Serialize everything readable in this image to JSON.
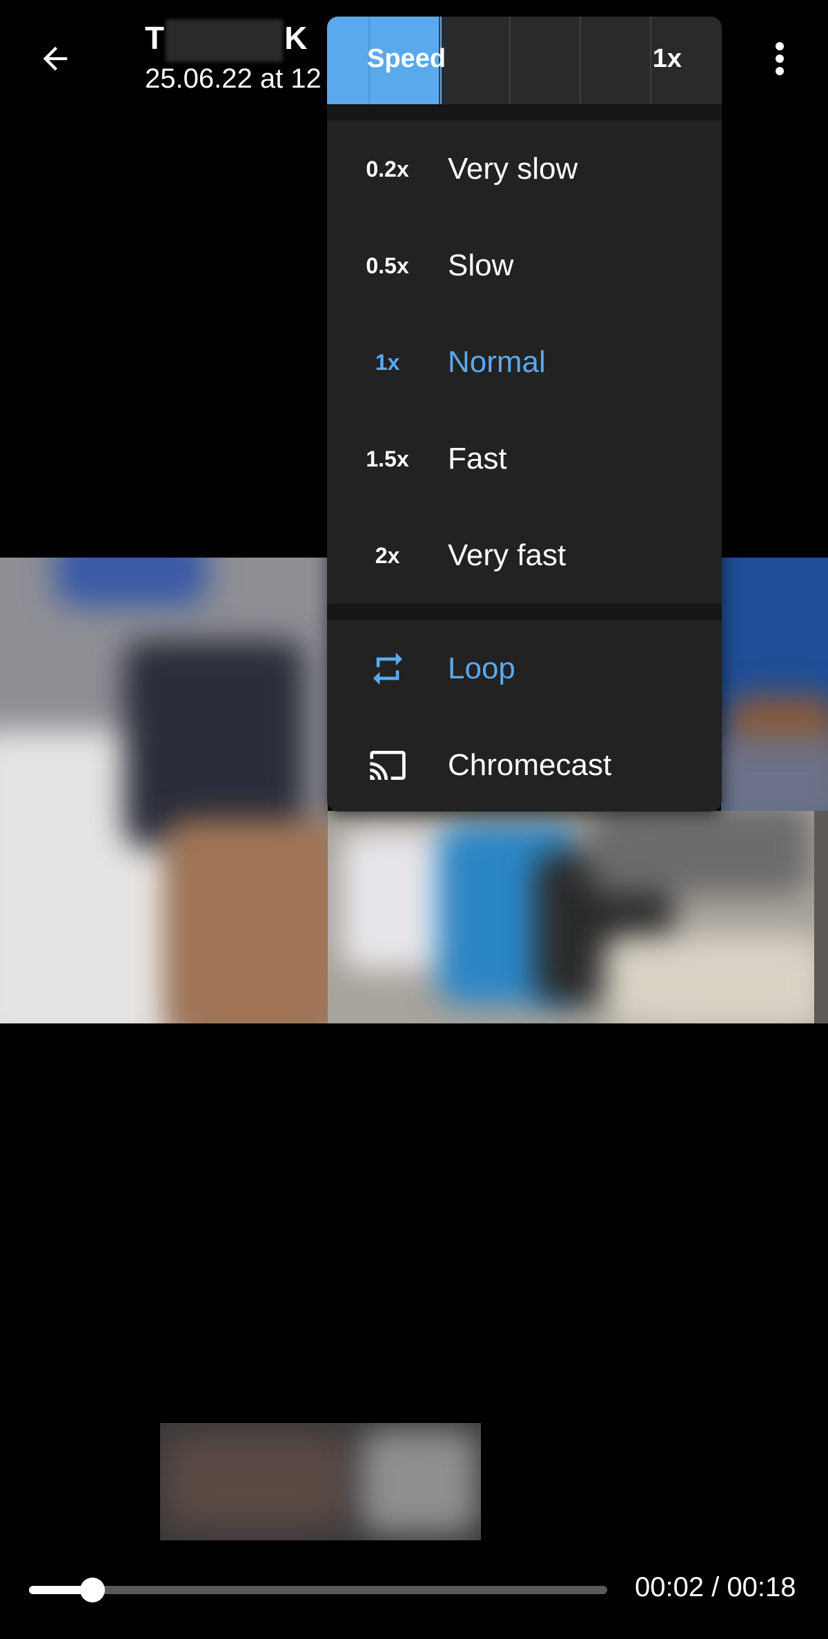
{
  "header": {
    "title_start": "T",
    "title_end": "K",
    "subtitle": "25.06.22 at 12"
  },
  "menu": {
    "speed_label": "Speed",
    "speed_value": "1x",
    "speed_level": 0.29,
    "items": [
      {
        "badge": "0.2x",
        "label": "Very slow",
        "active": false
      },
      {
        "badge": "0.5x",
        "label": "Slow",
        "active": false
      },
      {
        "badge": "1x",
        "label": "Normal",
        "active": true
      },
      {
        "badge": "1.5x",
        "label": "Fast",
        "active": false
      },
      {
        "badge": "2x",
        "label": "Very fast",
        "active": false
      }
    ],
    "loop_label": "Loop",
    "chromecast_label": "Chromecast"
  },
  "player": {
    "progress": 0.11,
    "time": "00:02 / 00:18"
  },
  "colors": {
    "accent": "#5aa9ec",
    "background": "#000000",
    "menu_bg": "#222222"
  },
  "icons": {
    "back": "arrow-left-icon",
    "more": "more-vertical-icon",
    "loop": "repeat-icon",
    "chromecast": "cast-icon"
  }
}
